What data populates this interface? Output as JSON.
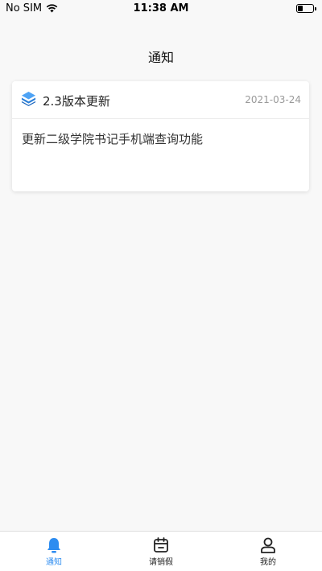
{
  "status": {
    "carrier": "No SIM",
    "time": "11:38 AM"
  },
  "nav": {
    "title": "通知"
  },
  "notices": [
    {
      "title": "2.3版本更新",
      "date": "2021-03-24",
      "content": "更新二级学院书记手机端查询功能"
    }
  ],
  "tabs": [
    {
      "label": "通知",
      "icon": "bell-icon",
      "active": true
    },
    {
      "label": "请销假",
      "icon": "calendar-icon",
      "active": false
    },
    {
      "label": "我的",
      "icon": "user-icon",
      "active": false
    }
  ],
  "colors": {
    "accent": "#2d8cf0",
    "background": "#f8f8f8"
  }
}
